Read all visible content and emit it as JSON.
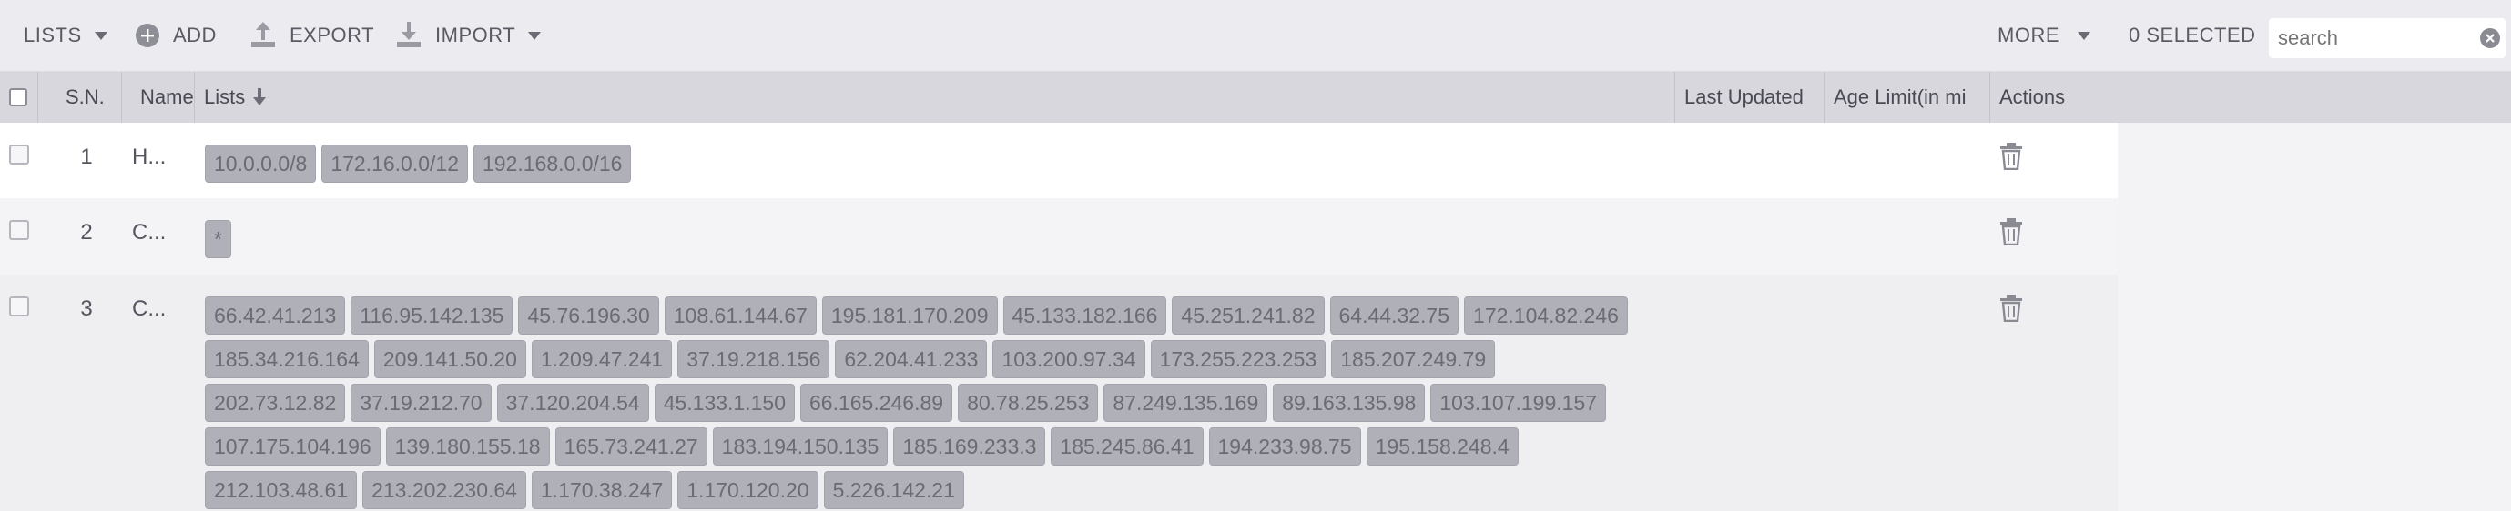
{
  "toolbar": {
    "lists_label": "LISTS",
    "add_label": "ADD",
    "export_label": "EXPORT",
    "import_label": "IMPORT",
    "more_label": "MORE",
    "selected_label": "0 SELECTED",
    "search_placeholder": "search"
  },
  "table": {
    "headers": {
      "sn": "S.N.",
      "name": "Name",
      "lists": "Lists",
      "last_updated": "Last Updated",
      "age_limit": "Age Limit(in mi",
      "actions": "Actions"
    },
    "rows": [
      {
        "sn": "1",
        "name": "H...",
        "tags": [
          "10.0.0.0/8",
          "172.16.0.0/12",
          "192.168.0.0/16"
        ]
      },
      {
        "sn": "2",
        "name": "C...",
        "tags": [
          "*"
        ]
      },
      {
        "sn": "3",
        "name": "C...",
        "tags": [
          "66.42.41.213",
          "116.95.142.135",
          "45.76.196.30",
          "108.61.144.67",
          "195.181.170.209",
          "45.133.182.166",
          "45.251.241.82",
          "64.44.32.75",
          "172.104.82.246",
          "185.34.216.164",
          "209.141.50.20",
          "1.209.47.241",
          "37.19.218.156",
          "62.204.41.233",
          "103.200.97.34",
          "173.255.223.253",
          "185.207.249.79",
          "202.73.12.82",
          "37.19.212.70",
          "37.120.204.54",
          "45.133.1.150",
          "66.165.246.89",
          "80.78.25.253",
          "87.249.135.169",
          "89.163.135.98",
          "103.107.199.157",
          "107.175.104.196",
          "139.180.155.18",
          "165.73.241.27",
          "183.194.150.135",
          "185.169.233.3",
          "185.245.86.41",
          "194.233.98.75",
          "195.158.248.4",
          "212.103.48.61",
          "213.202.230.64",
          "1.170.38.247",
          "1.170.120.20",
          "5.226.142.21"
        ]
      }
    ]
  },
  "colors": {
    "toolbar_bg": "#ececf0",
    "header_bg": "#d7d7dd",
    "tag_bg": "#b0b0b9"
  }
}
